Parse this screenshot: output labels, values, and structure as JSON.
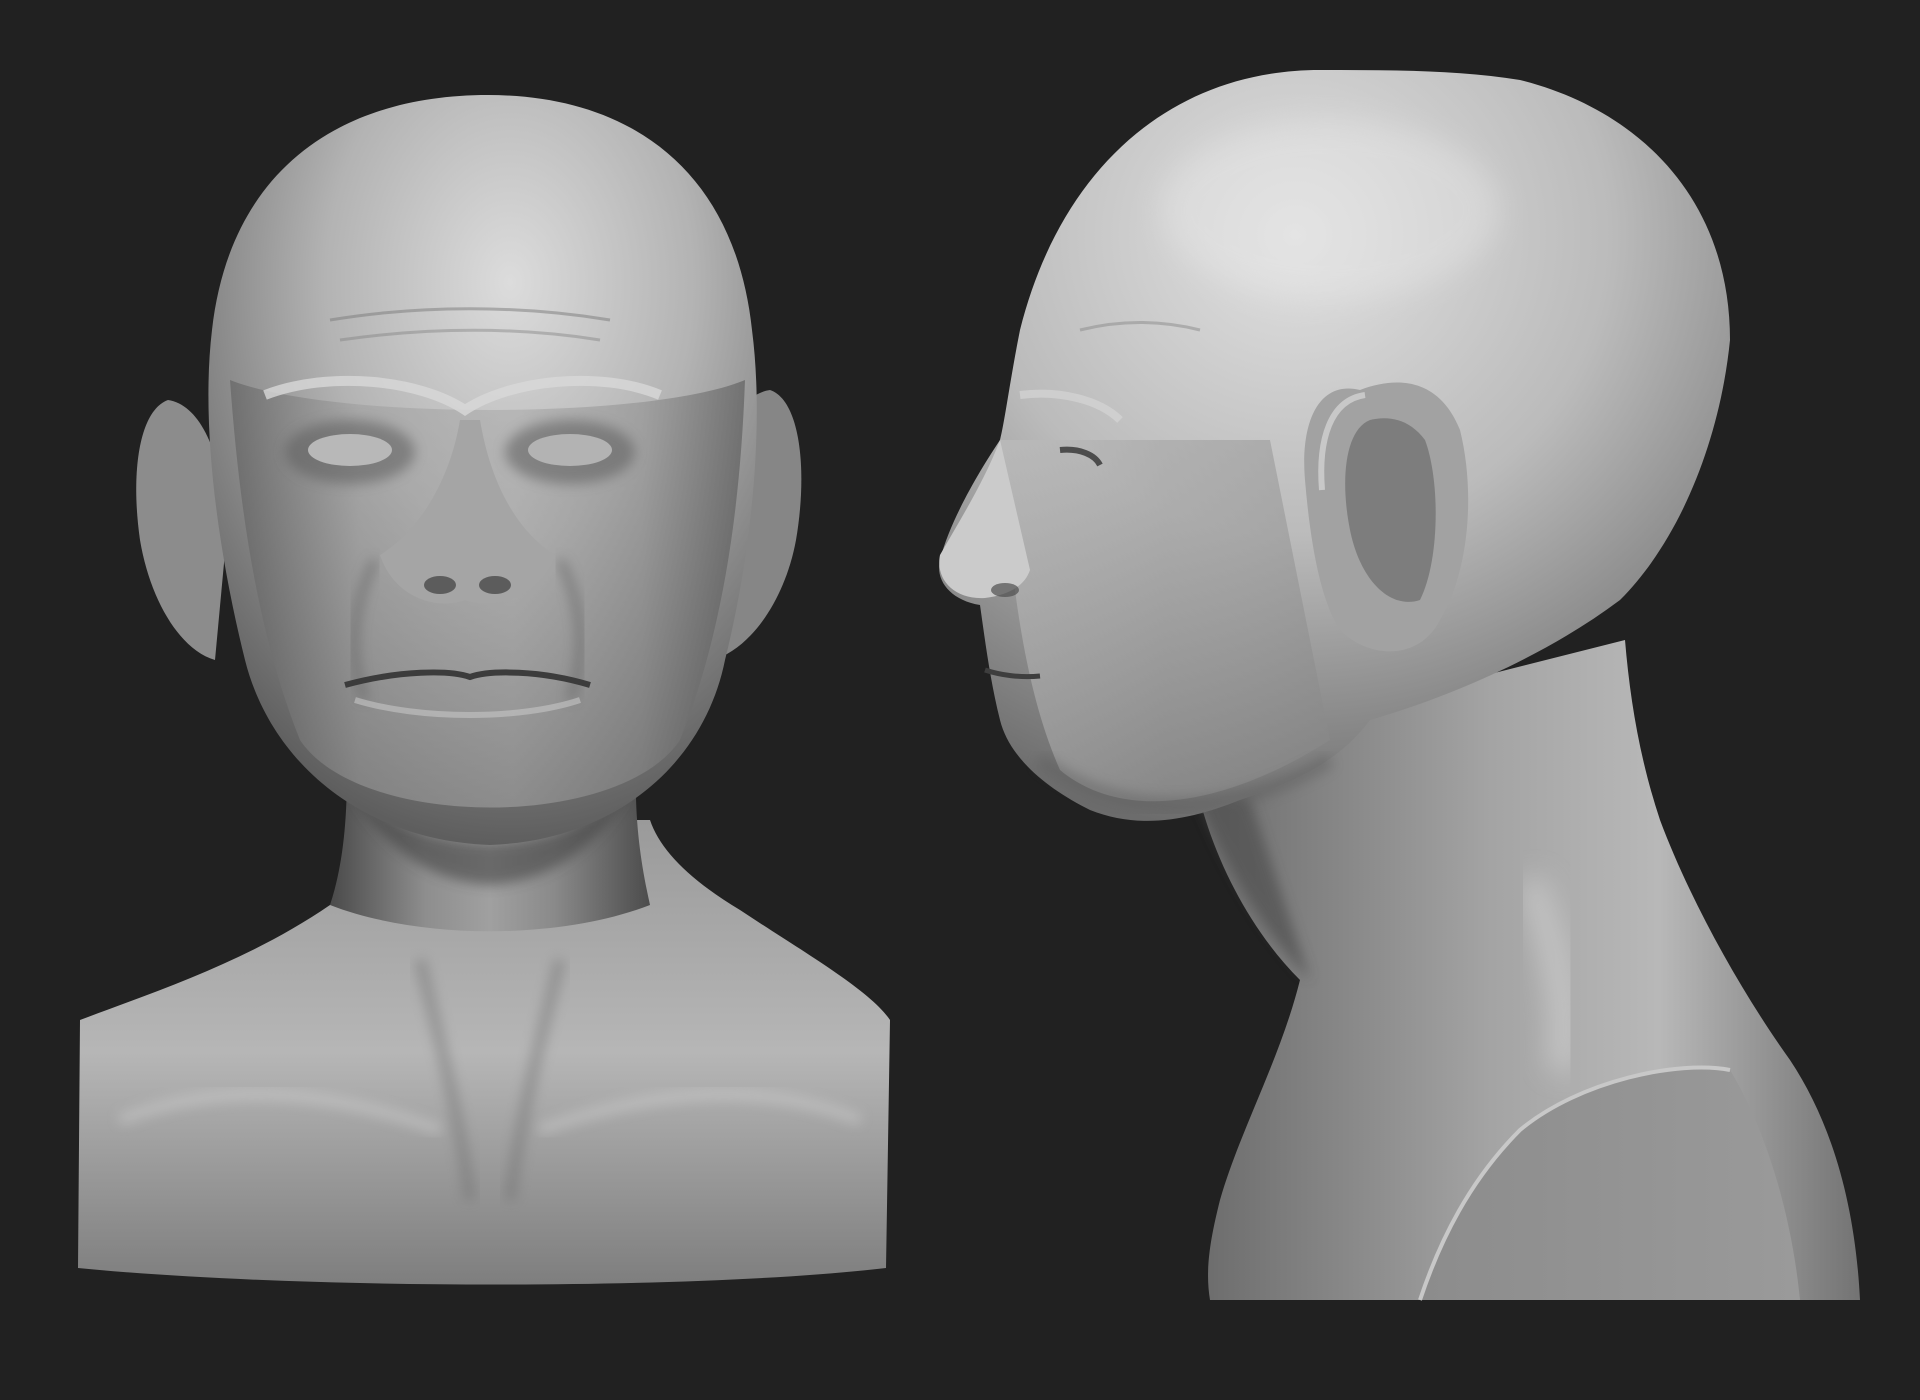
{
  "scene": {
    "background_color": "#212121",
    "material_color": "#9a9a9a",
    "views": [
      {
        "id": "front",
        "subject": "bald-head-bust"
      },
      {
        "id": "side",
        "subject": "bald-head-bust"
      }
    ]
  }
}
